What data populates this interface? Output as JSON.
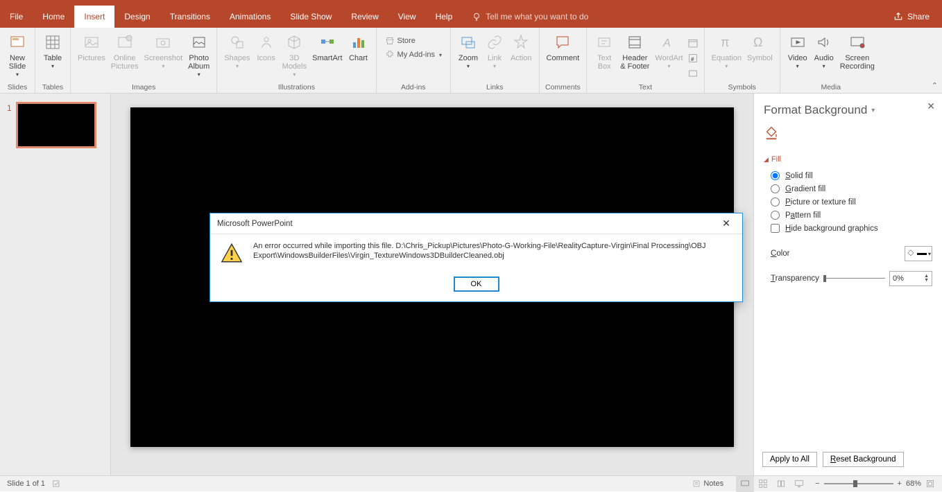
{
  "menu": {
    "file": "File",
    "home": "Home",
    "insert": "Insert",
    "design": "Design",
    "transitions": "Transitions",
    "animations": "Animations",
    "slideshow": "Slide Show",
    "review": "Review",
    "view": "View",
    "help": "Help",
    "tellme": "Tell me what you want to do",
    "share": "Share"
  },
  "ribbon": {
    "slides": {
      "new_slide": "New\nSlide",
      "label": "Slides"
    },
    "tables": {
      "table": "Table",
      "label": "Tables"
    },
    "images": {
      "pictures": "Pictures",
      "online": "Online\nPictures",
      "screenshot": "Screenshot",
      "album": "Photo\nAlbum",
      "label": "Images"
    },
    "illus": {
      "shapes": "Shapes",
      "icons": "Icons",
      "models": "3D\nModels",
      "smartart": "SmartArt",
      "chart": "Chart",
      "label": "Illustrations"
    },
    "addins": {
      "store": "Store",
      "myaddins": "My Add-ins",
      "label": "Add-ins"
    },
    "links": {
      "zoom": "Zoom",
      "link": "Link",
      "action": "Action",
      "label": "Links"
    },
    "comments": {
      "comment": "Comment",
      "label": "Comments"
    },
    "text": {
      "textbox": "Text\nBox",
      "headerfooter": "Header\n& Footer",
      "wordart": "WordArt",
      "label": "Text"
    },
    "symbols": {
      "equation": "Equation",
      "symbol": "Symbol",
      "label": "Symbols"
    },
    "media": {
      "video": "Video",
      "audio": "Audio",
      "screenrec": "Screen\nRecording",
      "label": "Media"
    }
  },
  "thumb": {
    "num": "1"
  },
  "panel": {
    "title": "Format Background",
    "fill": "Fill",
    "solid": "Solid fill",
    "gradient": "Gradient fill",
    "picture": "Picture or texture fill",
    "pattern": "Pattern fill",
    "hide": "Hide background graphics",
    "color": "Color",
    "transparency": "Transparency",
    "transval": "0%",
    "applyall": "Apply to All",
    "reset": "Reset Background"
  },
  "dialog": {
    "title": "Microsoft PowerPoint",
    "message": "An error occurred while importing this file. D:\\Chris_Pickup\\Pictures\\Photo-G-Working-File\\RealityCapture-Virgin\\Final Processing\\OBJ Export\\WindowsBuilderFiles\\Virgin_TextureWindows3DBuilderCleaned.obj",
    "ok": "OK"
  },
  "status": {
    "slide": "Slide 1 of 1",
    "notes": "Notes",
    "zoom": "68%"
  }
}
